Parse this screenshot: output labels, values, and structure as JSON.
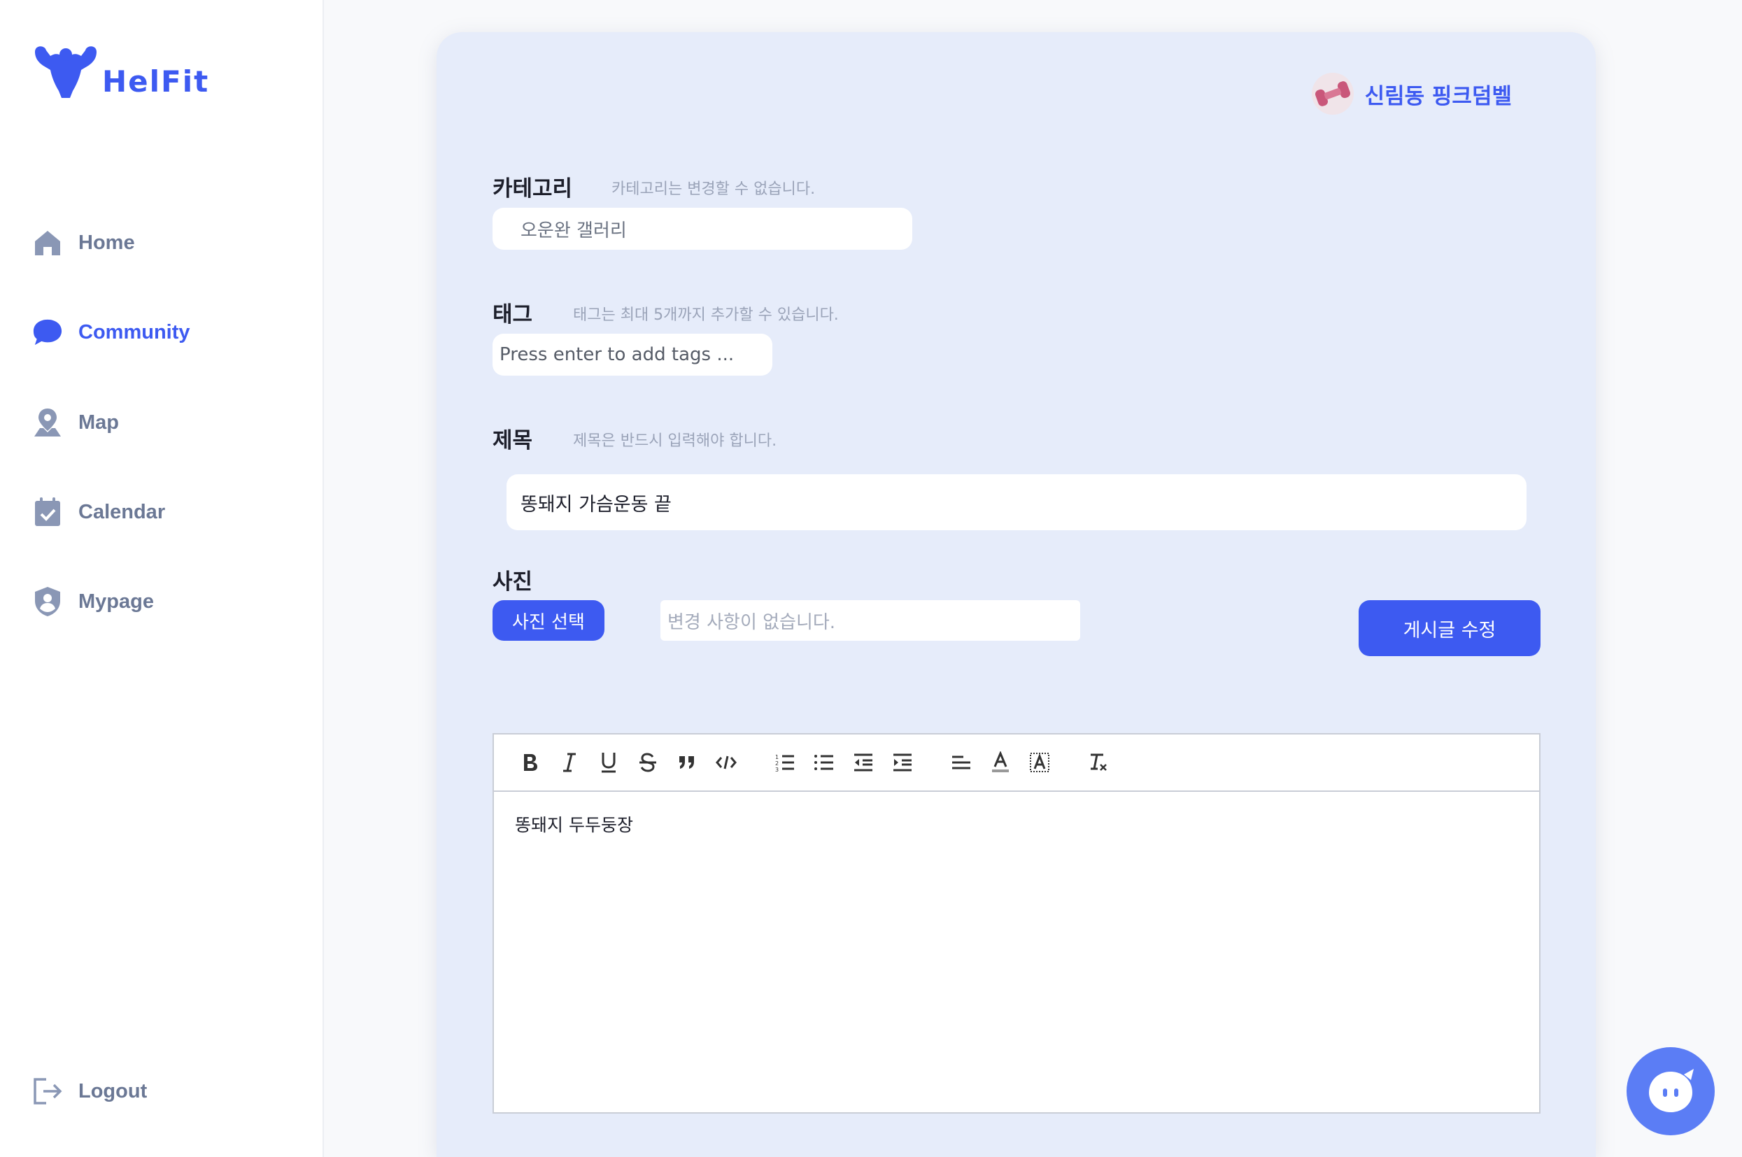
{
  "brand": {
    "name": "HelFit",
    "color": "#3d5af1"
  },
  "nav": {
    "items": [
      {
        "label": "Home",
        "icon": "home-icon"
      },
      {
        "label": "Community",
        "icon": "chat-icon",
        "active": true
      },
      {
        "label": "Map",
        "icon": "map-pin-icon"
      },
      {
        "label": "Calendar",
        "icon": "calendar-icon"
      },
      {
        "label": "Mypage",
        "icon": "shield-user-icon"
      }
    ],
    "logout": "Logout"
  },
  "user": {
    "name": "신림동 핑크덤벨",
    "avatar_icon": "pink-dumbbell-icon"
  },
  "form": {
    "category": {
      "label": "카테고리",
      "hint": "카테고리는 변경할 수 없습니다.",
      "value": "오운완 갤러리"
    },
    "tags": {
      "label": "태그",
      "hint": "태그는 최대 5개까지 추가할 수 있습니다.",
      "placeholder": "Press enter to add tags ..."
    },
    "title": {
      "label": "제목",
      "hint": "제목은 반드시 입력해야 합니다.",
      "value": "똥돼지 가슴운동 끝"
    },
    "photo": {
      "label": "사진",
      "button": "사진 선택",
      "status": "변경 사항이 없습니다."
    },
    "submit": "게시글 수정"
  },
  "editor": {
    "toolbar": [
      "bold",
      "italic",
      "underline",
      "strike",
      "blockquote",
      "code-block",
      "ordered-list",
      "bullet-list",
      "indent-decrease",
      "indent-increase",
      "align",
      "text-color",
      "background-color",
      "clear-format"
    ],
    "content": "똥돼지 두두둥장"
  },
  "colors": {
    "accent": "#3d5af1",
    "card_bg": "#e6ecfa",
    "nav_text": "#6b7895",
    "chat": "#5b7df5"
  }
}
